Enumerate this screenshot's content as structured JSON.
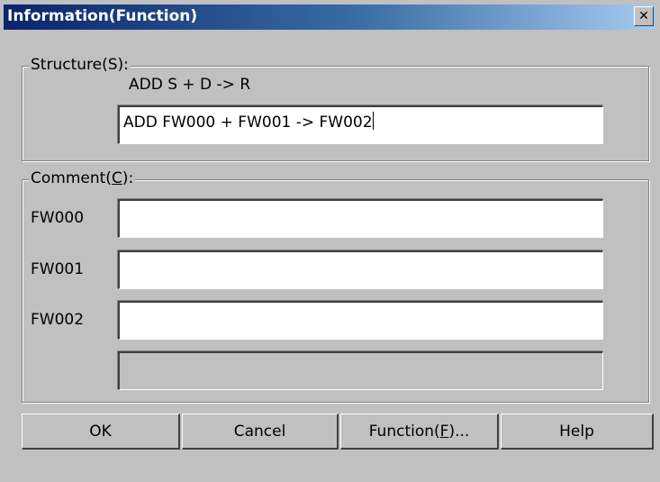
{
  "window": {
    "title": "Information(Function)",
    "close_glyph": "✕"
  },
  "structure": {
    "legend_prefix": "Structure(",
    "legend_key": "S",
    "legend_suffix": "):",
    "format": "ADD S + D -> R",
    "value": "ADD FW000 + FW001 -> FW002"
  },
  "comment": {
    "legend_prefix": "Comment(",
    "legend_key": "C",
    "legend_suffix": "):",
    "rows": [
      {
        "label": "FW000",
        "value": ""
      },
      {
        "label": "FW001",
        "value": ""
      },
      {
        "label": "FW002",
        "value": ""
      }
    ],
    "extra_value": ""
  },
  "buttons": {
    "ok": "OK",
    "cancel": "Cancel",
    "function_prefix": "Function(",
    "function_key": "F",
    "function_suffix": ")...",
    "help": "Help"
  }
}
